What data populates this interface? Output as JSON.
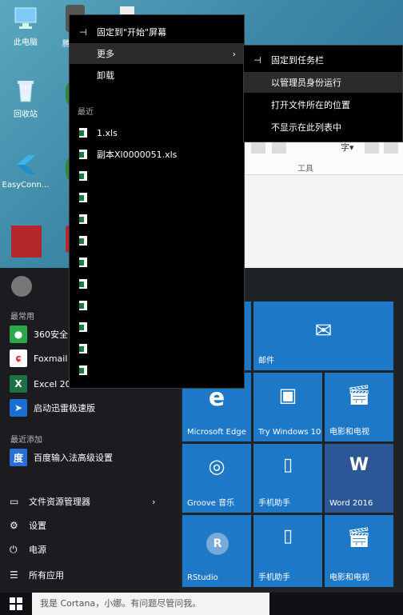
{
  "desktop": {
    "icons": [
      {
        "label": "此电脑",
        "icon": "computer-icon"
      },
      {
        "label": "回收站",
        "icon": "recycle-bin-icon"
      },
      {
        "label": "EasyConn...",
        "icon": "easyconnect-icon"
      }
    ],
    "partial_labels": {
      "second_col_top": "腾"
    }
  },
  "explorer": {
    "ribbon_group": "工具",
    "ribbon_glyph": "字▾"
  },
  "context_menu": {
    "pin_start": "固定到\"开始\"屏幕",
    "more": "更多",
    "uninstall": "卸载",
    "recent_header": "最近",
    "recent_files": [
      "1.xls",
      "副本Xl0000051.xls",
      "",
      "",
      "",
      "",
      "",
      "",
      "",
      "",
      "",
      ""
    ]
  },
  "submenu": {
    "pin_taskbar": "固定到任务栏",
    "run_as_admin": "以管理员身份运行",
    "open_location": "打开文件所在的位置",
    "hide_from_list": "不显示在此列表中"
  },
  "start_menu": {
    "most_used_header": "最常用",
    "most_used": [
      {
        "label": "360安全",
        "icon": "360-icon",
        "color": "#2aa84a"
      },
      {
        "label": "Foxmail",
        "icon": "foxmail-icon",
        "color": "#d8262b"
      },
      {
        "label": "Excel 20",
        "icon": "excel-icon",
        "color": "#1e7145"
      },
      {
        "label": "启动迅雷极速版",
        "icon": "thunder-icon",
        "color": "#1b6fd1"
      }
    ],
    "recent_added_header": "最近添加",
    "recent_added": [
      {
        "label": "百度输入法高级设置",
        "icon": "baidu-ime-icon",
        "color": "#2a6fd6"
      }
    ],
    "bottom": [
      {
        "label": "文件资源管理器",
        "icon": "file-explorer-icon"
      },
      {
        "label": "设置",
        "icon": "gear-icon"
      },
      {
        "label": "电源",
        "icon": "power-icon"
      },
      {
        "label": "所有应用",
        "icon": "all-apps-icon"
      }
    ]
  },
  "tiles": {
    "mail": "邮件",
    "edge": "Microsoft Edge",
    "try_windows": "Try Windows 10",
    "movies1": "电影和电视",
    "groove": "Groove 音乐",
    "phone1": "手机助手",
    "word": "Word 2016",
    "rstudio": "RStudio",
    "phone2": "手机助手",
    "movies2": "电影和电视"
  },
  "taskbar": {
    "cortana_placeholder": "我是 Cortana，小娜。有问题尽管问我。"
  }
}
